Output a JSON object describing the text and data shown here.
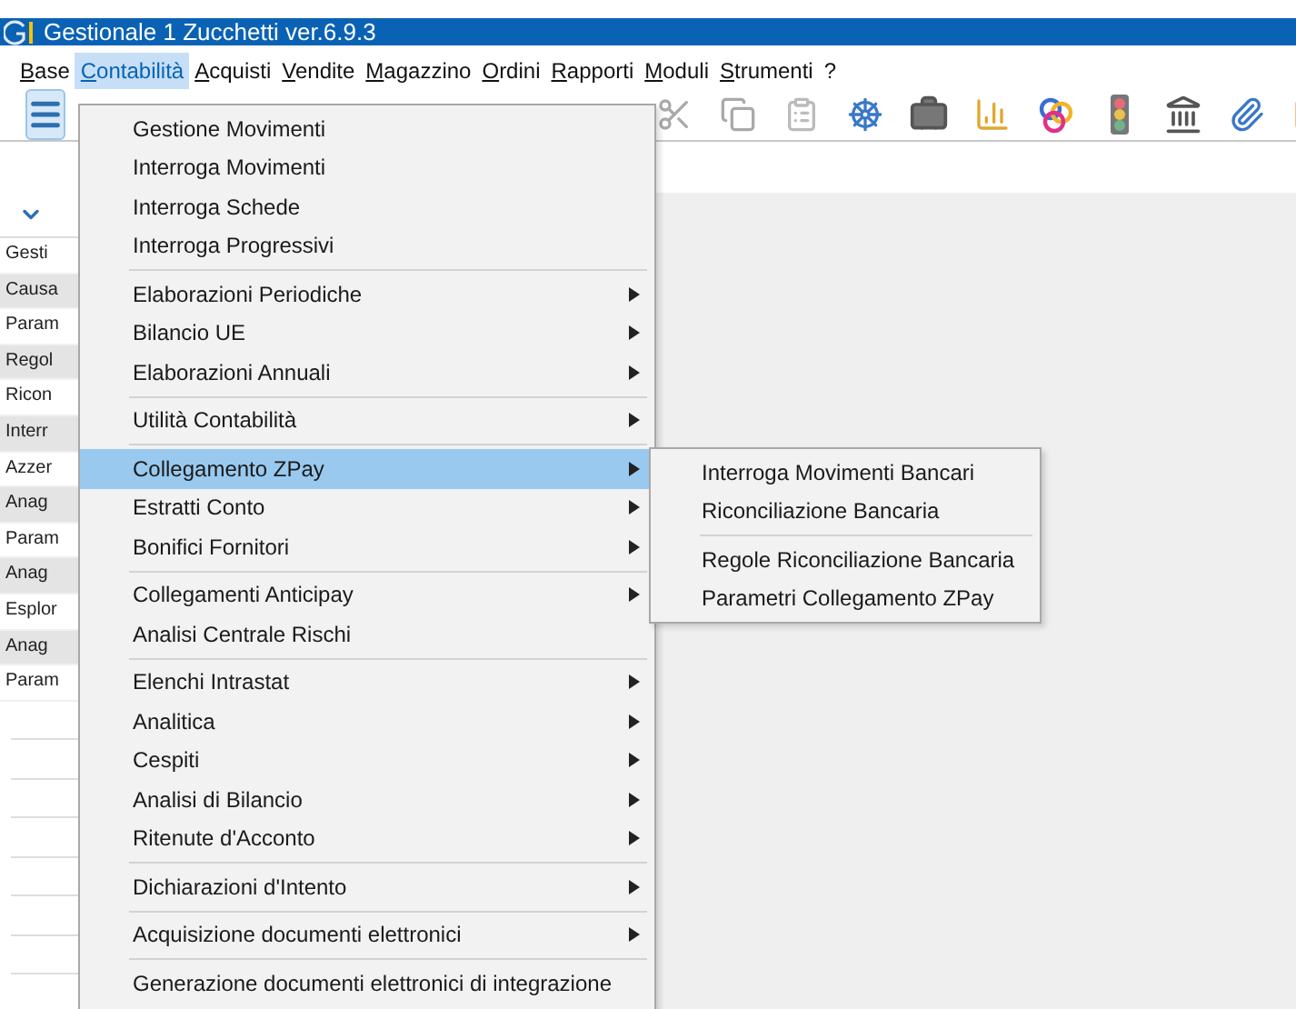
{
  "window": {
    "title": "Gestionale 1 Zucchetti ver.6.9.3"
  },
  "menu_bar": [
    {
      "label": "Base",
      "selected": false
    },
    {
      "label": "Contabilità",
      "selected": true
    },
    {
      "label": "Acquisti",
      "selected": false
    },
    {
      "label": "Vendite",
      "selected": false
    },
    {
      "label": "Magazzino",
      "selected": false
    },
    {
      "label": "Ordini",
      "selected": false
    },
    {
      "label": "Rapporti",
      "selected": false
    },
    {
      "label": "Moduli",
      "selected": false
    },
    {
      "label": "Strumenti",
      "selected": false
    },
    {
      "label": "?",
      "selected": false
    }
  ],
  "side_panel": {
    "rows": [
      {
        "label": "Gesti"
      },
      {
        "label": "Causa"
      },
      {
        "label": "Param"
      },
      {
        "label": "Regol"
      },
      {
        "label": "Ricon"
      },
      {
        "label": "Interr"
      },
      {
        "label": "Azzer"
      },
      {
        "label": "Anag"
      },
      {
        "label": "Param"
      },
      {
        "label": "Anag"
      },
      {
        "label": "Esplor"
      },
      {
        "label": "Anag"
      },
      {
        "label": "Param"
      }
    ]
  },
  "menu": {
    "groups": [
      [
        {
          "label": "Gestione Movimenti",
          "submenu": false,
          "selected": false
        },
        {
          "label": "Interroga Movimenti",
          "submenu": false,
          "selected": false
        },
        {
          "label": "Interroga Schede",
          "submenu": false,
          "selected": false
        },
        {
          "label": "Interroga Progressivi",
          "submenu": false,
          "selected": false
        }
      ],
      [
        {
          "label": "Elaborazioni Periodiche",
          "submenu": true,
          "selected": false
        },
        {
          "label": "Bilancio UE",
          "submenu": true,
          "selected": false
        },
        {
          "label": "Elaborazioni Annuali",
          "submenu": true,
          "selected": false
        }
      ],
      [
        {
          "label": "Utilità Contabilità",
          "submenu": true,
          "selected": false
        }
      ],
      [
        {
          "label": "Collegamento ZPay",
          "submenu": true,
          "selected": true
        },
        {
          "label": "Estratti Conto",
          "submenu": true,
          "selected": false
        },
        {
          "label": "Bonifici Fornitori",
          "submenu": true,
          "selected": false
        }
      ],
      [
        {
          "label": "Collegamenti Anticipay",
          "submenu": true,
          "selected": false
        },
        {
          "label": "Analisi Centrale Rischi",
          "submenu": false,
          "selected": false
        }
      ],
      [
        {
          "label": "Elenchi Intrastat",
          "submenu": true,
          "selected": false
        },
        {
          "label": "Analitica",
          "submenu": true,
          "selected": false
        },
        {
          "label": "Cespiti",
          "submenu": true,
          "selected": false
        },
        {
          "label": "Analisi di Bilancio",
          "submenu": true,
          "selected": false
        },
        {
          "label": "Ritenute d'Acconto",
          "submenu": true,
          "selected": false
        }
      ],
      [
        {
          "label": "Dichiarazioni d'Intento",
          "submenu": true,
          "selected": false
        }
      ],
      [
        {
          "label": "Acquisizione documenti elettronici",
          "submenu": true,
          "selected": false
        }
      ],
      [
        {
          "label": "Generazione documenti elettronici di integrazione",
          "submenu": false,
          "selected": false
        }
      ]
    ]
  },
  "submenu": {
    "groups": [
      [
        {
          "label": "Interroga Movimenti Bancari",
          "selected": false
        },
        {
          "label": "Riconciliazione Bancaria",
          "selected": false
        }
      ],
      [
        {
          "label": "Regole Riconciliazione Bancaria",
          "selected": false
        },
        {
          "label": "Parametri Collegamento ZPay",
          "selected": false
        }
      ]
    ]
  }
}
